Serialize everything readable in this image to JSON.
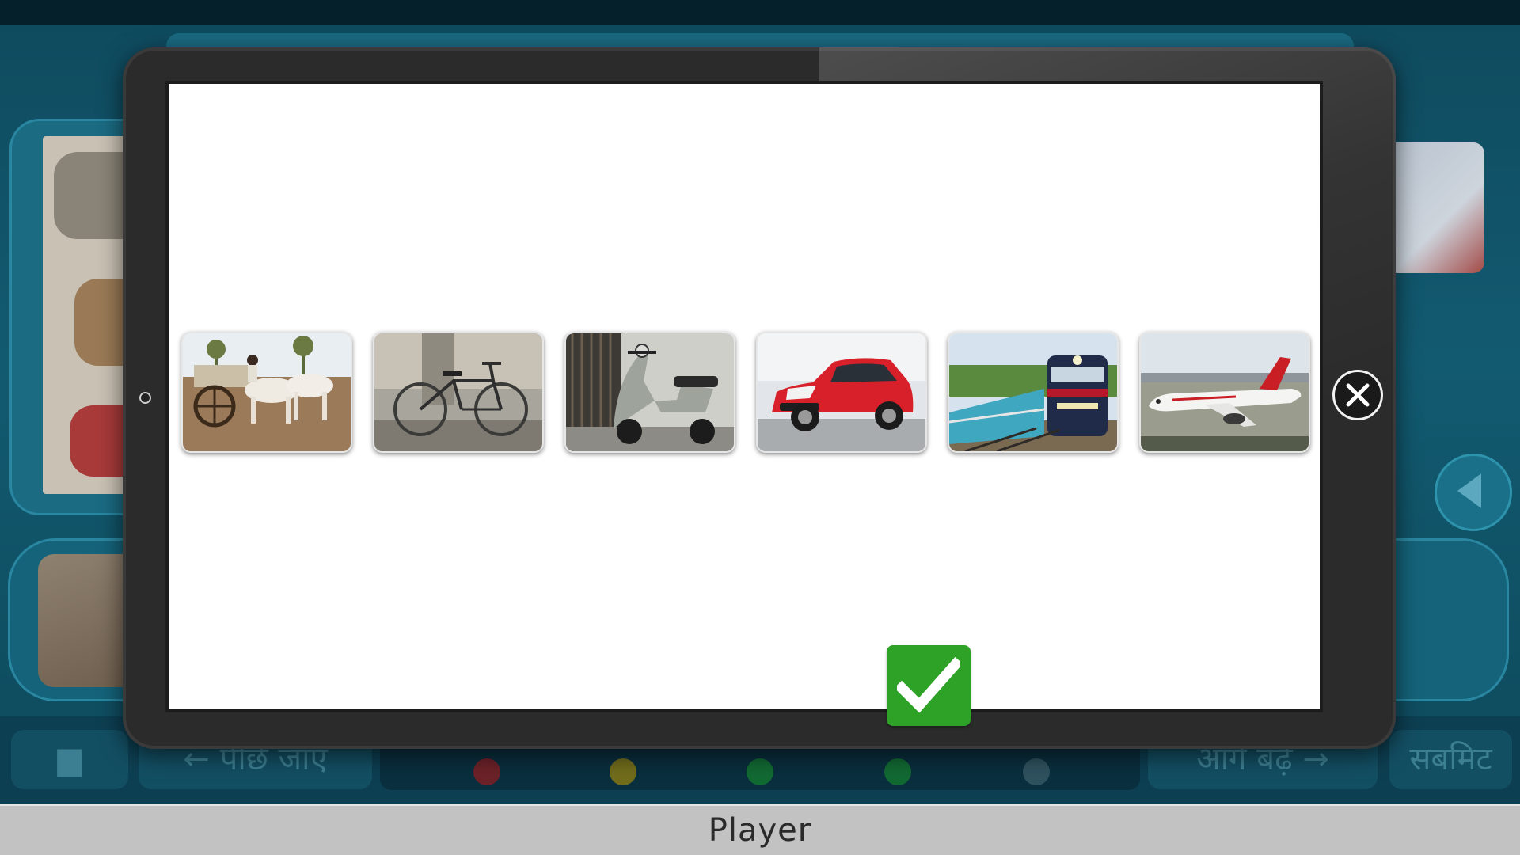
{
  "window": {
    "title": "Player"
  },
  "background": {
    "back_label": "पीछे जाएं",
    "next_label": "आगे बढ़ें",
    "submit_label": "सबमिट",
    "progress_dot_colors": [
      "#c01818",
      "#c9a000",
      "#1a9a2a",
      "#1a9a2a",
      "#4f6f7a"
    ]
  },
  "modal": {
    "cards": [
      {
        "icon": "bullock-cart-image"
      },
      {
        "icon": "bicycle-image"
      },
      {
        "icon": "scooter-image"
      },
      {
        "icon": "red-car-image"
      },
      {
        "icon": "train-image"
      },
      {
        "icon": "airplane-image"
      }
    ],
    "submit_icon": "checkmark-icon",
    "close_icon": "close-icon"
  },
  "colors": {
    "check_green": "#2ea227",
    "modal_frame": "#2b2b2b",
    "title_bar": "#c2c2c2"
  }
}
